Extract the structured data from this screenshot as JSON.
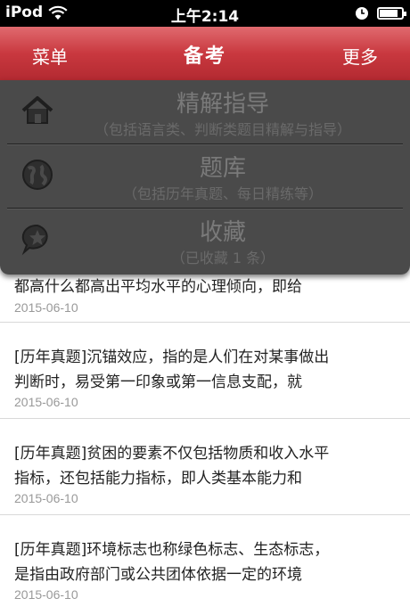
{
  "status_bar": {
    "carrier": "iPod",
    "time": "上午2:14",
    "battery_level": 0.85
  },
  "nav": {
    "left": "菜单",
    "title": "备考",
    "right": "更多"
  },
  "menu": [
    {
      "icon": "home-icon",
      "title": "精解指导",
      "subtitle": "（包括语言类、判断类题目精解与指导）"
    },
    {
      "icon": "globe-icon",
      "title": "题库",
      "subtitle": "（包括历年真题、每日精练等）"
    },
    {
      "icon": "star-bubble-icon",
      "title": "收藏",
      "subtitle": "（已收藏 1 条）"
    }
  ],
  "list": [
    {
      "lines": [
        "都高什么都高出平均水平的心理倾向，即给"
      ],
      "date": "2015-06-10"
    },
    {
      "lines": [
        "[历年真题]沉锚效应，指的是人们在对某事做出",
        "判断时，易受第一印象或第一信息支配，就"
      ],
      "date": "2015-06-10"
    },
    {
      "lines": [
        "[历年真题]贫困的要素不仅包括物质和收入水平",
        "指标，还包括能力指标，即人类基本能力和"
      ],
      "date": "2015-06-10"
    },
    {
      "lines": [
        "[历年真题]环境标志也称绿色标志、生态标志，",
        "是指由政府部门或公共团体依据一定的环境"
      ],
      "date": "2015-06-10"
    }
  ]
}
